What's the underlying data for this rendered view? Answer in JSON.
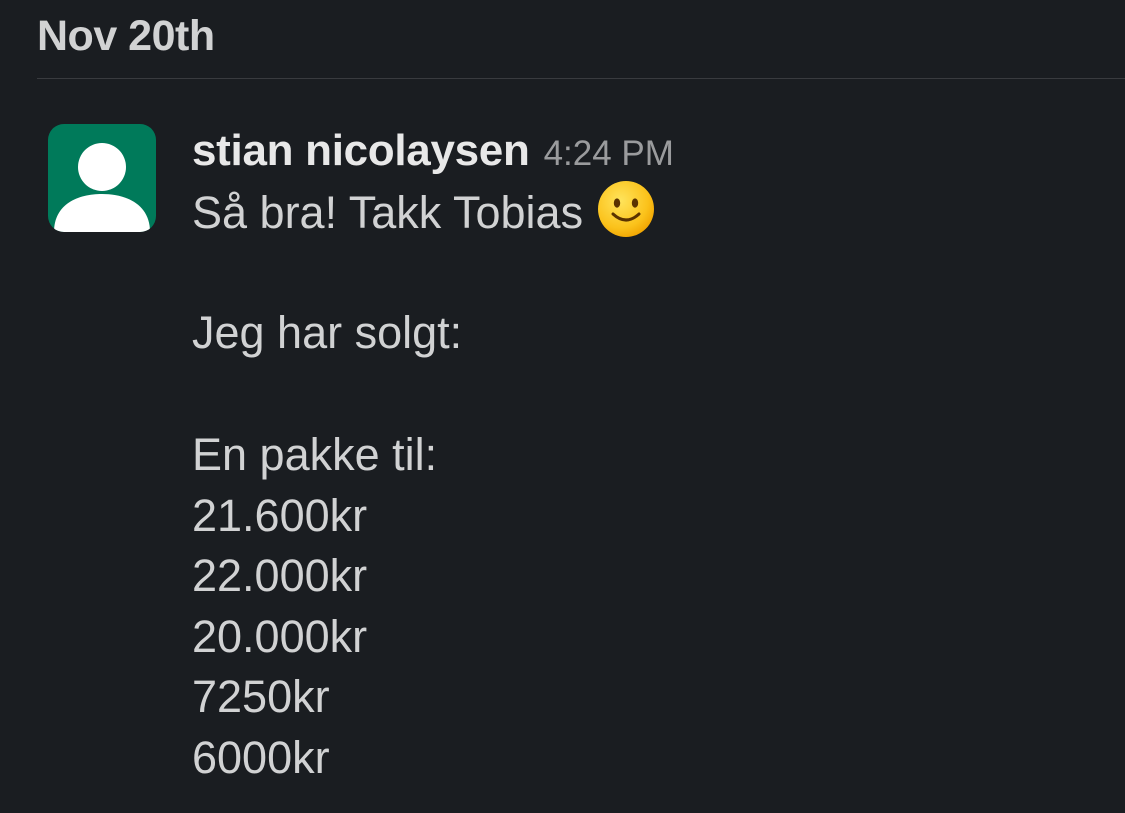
{
  "date_divider": "Nov 20th",
  "message": {
    "author": "stian nicolaysen",
    "timestamp": "4:24 PM",
    "line1": "Så bra! Takk Tobias",
    "line1_emoji": "slightly-smiling-face-icon",
    "line2": "Jeg har solgt:",
    "line3": "En pakke til:",
    "amounts": [
      "21.600kr",
      "22.000kr",
      "20.000kr",
      "7250kr",
      "6000kr"
    ]
  },
  "colors": {
    "background": "#1a1d21",
    "text": "#d1d2d3",
    "muted": "#9a9b9d",
    "avatar": "#007a5a"
  }
}
